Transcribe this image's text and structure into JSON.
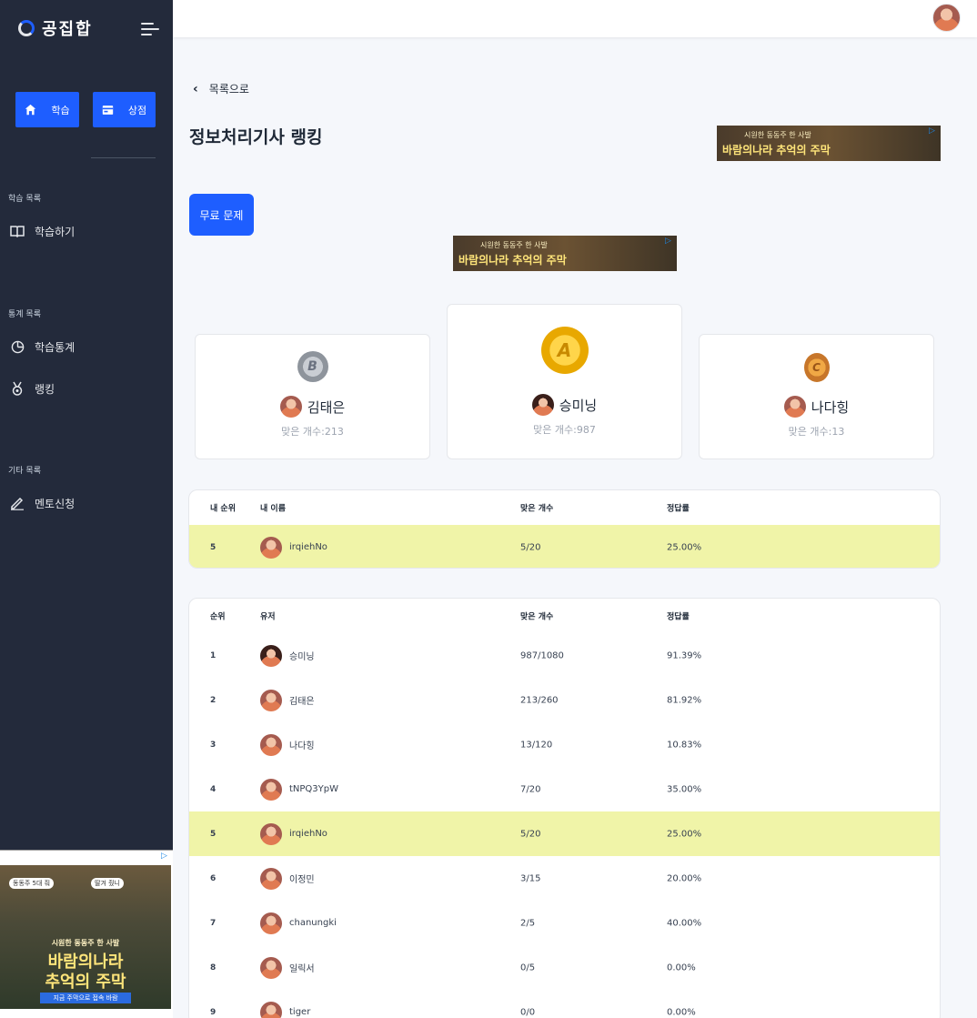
{
  "sidebar": {
    "brand": "공집합",
    "learn_button": "학습",
    "shop_button": "상점",
    "sections": [
      {
        "label": "학습 목록",
        "items": [
          {
            "label": "학습하기",
            "icon": "book-icon"
          }
        ]
      },
      {
        "label": "통계 목록",
        "items": [
          {
            "label": "학습통계",
            "icon": "pie-chart-icon"
          },
          {
            "label": "랭킹",
            "icon": "medal-icon"
          }
        ]
      },
      {
        "label": "기타 목록",
        "items": [
          {
            "label": "멘토신청",
            "icon": "pencil-icon"
          }
        ]
      }
    ],
    "ad": {
      "line1": "시원한 동동주 한 사발",
      "line2": "바람의나라",
      "line3": "추억의 주막",
      "cta": "지금 주막으로 접속 바람",
      "bubble1": "동동주 5대 줘",
      "bubble2": "딸겨 줬니"
    }
  },
  "header": {
    "avatar": "user-avatar"
  },
  "main": {
    "back_label": "목록으로",
    "title": "정보처리기사 랭킹",
    "free_button": "무료 문제",
    "ad_banner": {
      "line1": "시원한 동동주 한 사발",
      "line2": "바람의나라 추억의 주막"
    },
    "podium": [
      {
        "place": 2,
        "medal": "B",
        "name": "김태은",
        "sub": "맞은 개수:213"
      },
      {
        "place": 1,
        "medal": "A",
        "name": "승미닝",
        "sub": "맞은 개수:987"
      },
      {
        "place": 3,
        "medal": "C",
        "name": "나다힝",
        "sub": "맞은 개수:13"
      }
    ],
    "my_table": {
      "headers": [
        "내 순위",
        "내 이름",
        "맞은 개수",
        "정답률"
      ],
      "row": {
        "rank": "5",
        "name": "irqiehNo",
        "correct": "5/20",
        "rate": "25.00%"
      }
    },
    "rank_table": {
      "headers": [
        "순위",
        "유저",
        "맞은 개수",
        "정답률"
      ],
      "rows": [
        {
          "rank": "1",
          "name": "승미닝",
          "correct": "987/1080",
          "rate": "91.39%"
        },
        {
          "rank": "2",
          "name": "김태은",
          "correct": "213/260",
          "rate": "81.92%"
        },
        {
          "rank": "3",
          "name": "나다힝",
          "correct": "13/120",
          "rate": "10.83%"
        },
        {
          "rank": "4",
          "name": "tNPQ3YpW",
          "correct": "7/20",
          "rate": "35.00%"
        },
        {
          "rank": "5",
          "name": "irqiehNo",
          "correct": "5/20",
          "rate": "25.00%"
        },
        {
          "rank": "6",
          "name": "이정민",
          "correct": "3/15",
          "rate": "20.00%"
        },
        {
          "rank": "7",
          "name": "chanungki",
          "correct": "2/5",
          "rate": "40.00%"
        },
        {
          "rank": "8",
          "name": "일릭서",
          "correct": "0/5",
          "rate": "0.00%"
        },
        {
          "rank": "9",
          "name": "tiger",
          "correct": "0/0",
          "rate": "0.00%"
        }
      ]
    }
  }
}
